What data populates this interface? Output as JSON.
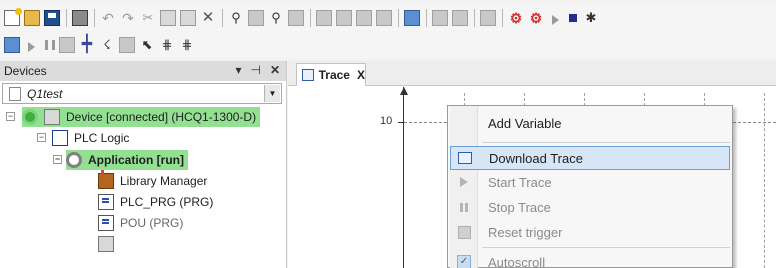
{
  "toolbar1": {
    "icons": [
      "new-project-icon",
      "open-folder-icon",
      "save-icon",
      "print-icon",
      "undo-icon",
      "redo-icon",
      "cut-icon",
      "copy-icon",
      "paste-icon",
      "delete-icon",
      "find-icon",
      "find-replace-icon",
      "binoculars-icon",
      "find-next-icon",
      "bookmark-icon",
      "step-icon",
      "step-into-icon",
      "step-out-icon",
      "monitor-icon",
      "tree-icon",
      "window-icon",
      "grid-icon",
      "online-icon",
      "login-icon",
      "run-icon",
      "stop-icon",
      "debug-icon"
    ]
  },
  "toolbar2": {
    "icons": [
      "trace-chart-icon",
      "play-icon",
      "pause-icon",
      "blank-icon",
      "crosshair-icon",
      "cursor-icon",
      "zoom-icon",
      "pointer-icon",
      "grid-pattern-icon",
      "grid-pattern-2-icon"
    ]
  },
  "devices_panel": {
    "title": "Devices",
    "pin_glyph": "▾ ⊣ ✕",
    "project_name": "Q1test",
    "tree": [
      {
        "label": "Device [connected] (HCQ1-1300-D)",
        "highlight": true
      },
      {
        "label": "PLC Logic",
        "highlight": false
      },
      {
        "label": "Application [run]",
        "highlight": true,
        "bold": true
      },
      {
        "label": "Library Manager",
        "highlight": false
      },
      {
        "label": "PLC_PRG (PRG)",
        "highlight": false
      },
      {
        "label": "POU (PRG)",
        "highlight": false,
        "dim": true
      }
    ]
  },
  "editor": {
    "tab_label": "Trace",
    "tab_close": "X",
    "y_tick_label": "10"
  },
  "context_menu": {
    "items": [
      {
        "label": "Add Variable",
        "enabled": true,
        "selected": false,
        "icon": "none"
      },
      {
        "label": "Download Trace",
        "enabled": true,
        "selected": true,
        "icon": "chart-icon"
      },
      {
        "label": "Start Trace",
        "enabled": false,
        "selected": false,
        "icon": "play-icon"
      },
      {
        "label": "Stop Trace",
        "enabled": false,
        "selected": false,
        "icon": "pause-icon"
      },
      {
        "label": "Reset trigger",
        "enabled": false,
        "selected": false,
        "icon": "reset-icon"
      },
      {
        "label": "Autoscroll",
        "enabled": false,
        "selected": false,
        "icon": "checked-icon"
      }
    ]
  },
  "colors": {
    "highlight_green": "#93e093",
    "menu_selected": "#d6e6f6",
    "menu_selected_border": "#6aa0d8"
  }
}
